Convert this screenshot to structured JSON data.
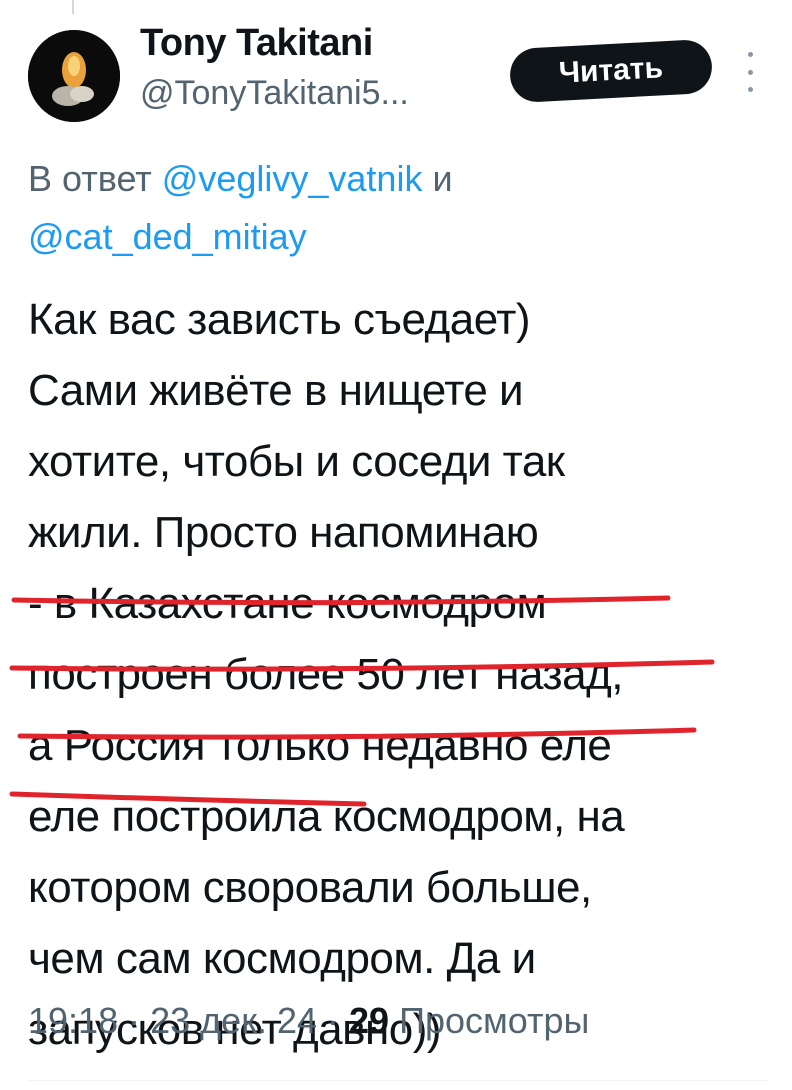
{
  "author": {
    "display_name": "Tony Takitani",
    "handle": "@TonyTakitani5..."
  },
  "follow_button_label": "Читать",
  "reply_context": {
    "prefix": "В ответ",
    "mention_1": "@veglivy_vatnik",
    "conjunction": "и",
    "mention_2": "@cat_ded_mitiay"
  },
  "tweet_lines": [
    "Как вас зависть съедает)",
    "Сами живёте в нищете и",
    "хотите, чтобы и соседи так",
    "жили. Просто напоминаю",
    "- в Казахстане космодром",
    "построен более 50 лет назад,",
    "а Россия только недавно еле",
    "еле построила космодром, на",
    "котором своровали больше,",
    "чем сам космодром. Да и",
    "запусков нет давно))"
  ],
  "meta": {
    "time": "19:18",
    "date": "23 дек. 24",
    "separator": "·",
    "views_count": "29",
    "views_label": "Просмотры"
  },
  "colors": {
    "accent_link": "#1d9bf0",
    "underline_red": "#e0242c",
    "secondary_text": "#536471",
    "primary_text": "#0f1419"
  }
}
